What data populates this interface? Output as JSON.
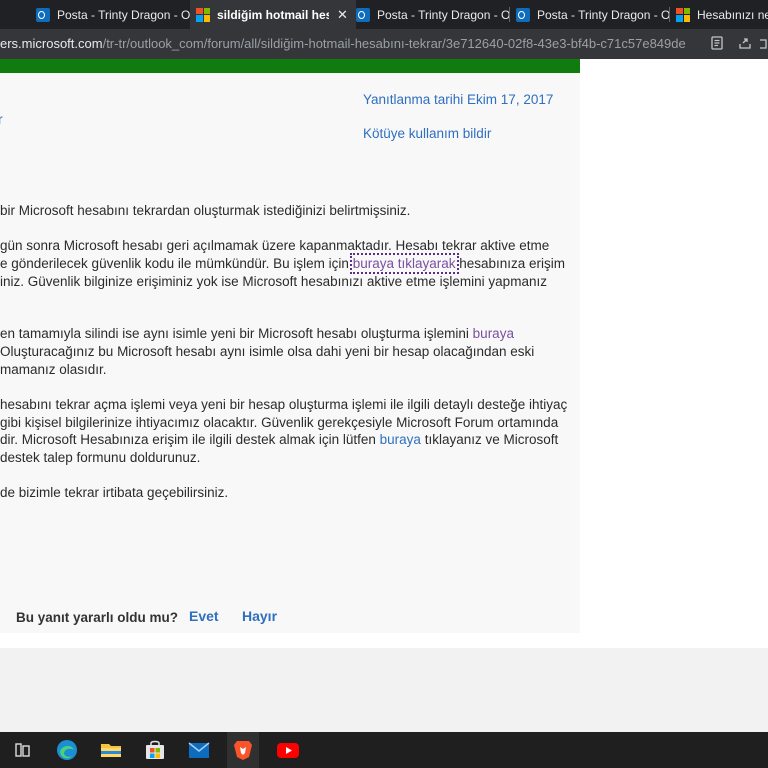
{
  "browser": {
    "tabs": [
      {
        "title": "Posta - Trinty Dragon - Out",
        "icon": "outlook-icon",
        "active": false
      },
      {
        "title": "sildiğim hotmail hesab",
        "icon": "microsoft-icon",
        "active": true
      },
      {
        "title": "Posta - Trinty Dragon - Out",
        "icon": "outlook-icon",
        "active": false
      },
      {
        "title": "Posta - Trinty Dragon - Out",
        "icon": "outlook-icon",
        "active": false
      },
      {
        "title": "Hesabınızı ne z",
        "icon": "microsoft-icon",
        "active": false
      }
    ],
    "tab_close": "✕",
    "url_host": "ers.microsoft.com",
    "url_path": "/tr-tr/outlook_com/forum/all/sildiğim-hotmail-hesabını-tekrar/3e712640-02f8-43e3-bf4b-c71c57e849de"
  },
  "post": {
    "left_fragment": "r",
    "replied_date": "Yanıtlanma tarihi Ekim 17, 2017",
    "report_abuse": "Kötüye kullanım bildir",
    "lines": [
      {
        "pre": "bir Microsoft hesabını tekrardan oluşturmak istediğinizi belirtmişsiniz.",
        "link": "",
        "post": ""
      },
      {
        "pre": " gün sonra Microsoft hesabı geri açılmamak üzere kapanmaktadır. Hesabı tekrar aktive etme",
        "link": "",
        "post": ""
      },
      {
        "pre": "e gönderilecek güvenlik kodu ile mümkündür. Bu işlem için ",
        "link": "buraya tıklayarak",
        "post": " hesabınıza erişim"
      },
      {
        "pre": "iniz. Güvenlik bilginize erişiminiz yok ise Microsoft hesabınızı aktive etme işlemini yapmanız",
        "link": "",
        "post": ""
      },
      {
        "pre": "en tamamıyla silindi ise aynı isimle yeni bir Microsoft hesabı oluşturma işlemini ",
        "link": "buraya",
        "post": ""
      },
      {
        "pre": " Oluşturacağınız bu Microsoft hesabı aynı isimle olsa dahi yeni bir hesap olacağından eski",
        "link": "",
        "post": ""
      },
      {
        "pre": "mamanız olasıdır.",
        "link": "",
        "post": ""
      },
      {
        "pre": "hesabını tekrar açma işlemi veya yeni bir hesap oluşturma işlemi ile ilgili detaylı desteğe ihtiyaç",
        "link": "",
        "post": ""
      },
      {
        "pre": " gibi kişisel bilgilerinize ihtiyacımız olacaktır. Güvenlik gerekçesiyle Microsoft Forum ortamında",
        "link": "",
        "post": ""
      },
      {
        "pre": "dir. Microsoft Hesabınıza erişim ile ilgili destek almak için lütfen ",
        "link": "buraya",
        "post": " tıklayanız ve Microsoft"
      },
      {
        "pre": "destek talep formunu doldurunuz.",
        "link": "",
        "post": ""
      },
      {
        "pre": "de bizimle tekrar irtibata geçebilirsiniz.",
        "link": "",
        "post": ""
      }
    ]
  },
  "feedback": {
    "question": "Bu yanıt yararlı oldu mu?",
    "yes": "Evet",
    "no": "Hayır"
  },
  "colors": {
    "accent_green": "#107c10",
    "link_blue": "#2f6fc0",
    "link_visited": "#7a4fa0"
  },
  "taskbar": {
    "icons": [
      "task-view-icon",
      "edge-icon",
      "file-explorer-icon",
      "microsoft-store-icon",
      "mail-icon",
      "brave-icon",
      "youtube-icon"
    ]
  }
}
